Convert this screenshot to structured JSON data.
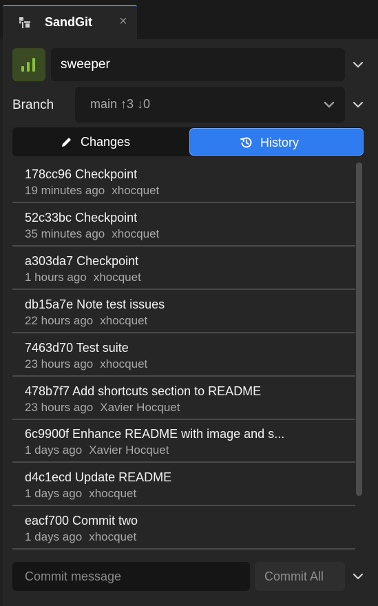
{
  "tab": {
    "title": "SandGit",
    "close_glyph": "×",
    "icon": "git-repo-icon"
  },
  "repo": {
    "name": "sweeper",
    "icon": "signal-bars-icon",
    "icon_color": "#86c23c"
  },
  "branch": {
    "label": "Branch",
    "value": "main ↑3 ↓0"
  },
  "view_toggle": {
    "changes_label": "Changes",
    "history_label": "History",
    "active": "history",
    "active_color": "#2f7bf0"
  },
  "commits": [
    {
      "message": "178cc96 Checkpoint",
      "time": "19 minutes ago",
      "author": "xhocquet"
    },
    {
      "message": "52c33bc Checkpoint",
      "time": "35 minutes ago",
      "author": "xhocquet"
    },
    {
      "message": "a303da7 Checkpoint",
      "time": "1 hours ago",
      "author": "xhocquet"
    },
    {
      "message": "db15a7e Note test issues",
      "time": "22 hours ago",
      "author": "xhocquet"
    },
    {
      "message": "7463d70 Test suite",
      "time": "23 hours ago",
      "author": "xhocquet"
    },
    {
      "message": "478b7f7 Add shortcuts section to README",
      "time": "23 hours ago",
      "author": "Xavier Hocquet"
    },
    {
      "message": "6c9900f Enhance README with image and s...",
      "time": "1 days ago",
      "author": "Xavier Hocquet"
    },
    {
      "message": "d4c1ecd Update README",
      "time": "1 days ago",
      "author": "xhocquet"
    },
    {
      "message": "eacf700 Commit two",
      "time": "1 days ago",
      "author": "xhocquet"
    }
  ],
  "commit_bar": {
    "placeholder": "Commit message",
    "button_label": "Commit All"
  }
}
